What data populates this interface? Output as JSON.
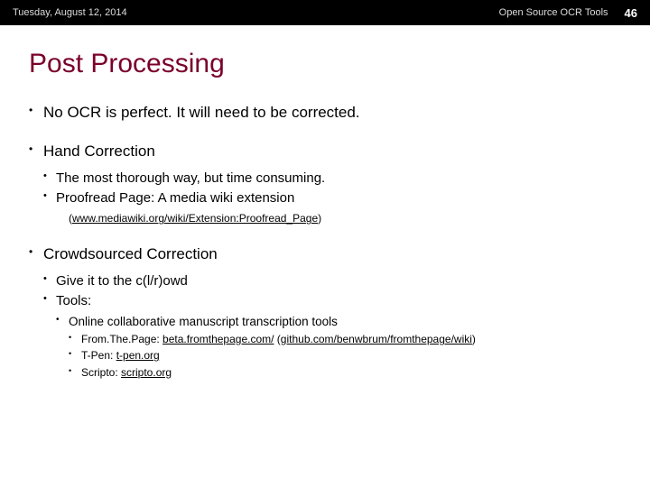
{
  "header": {
    "date": "Tuesday, August 12, 2014",
    "topic": "Open Source OCR Tools",
    "page": "46"
  },
  "title": "Post Processing",
  "bullets": {
    "b1": "No OCR is perfect. It will need to be corrected.",
    "b2": "Hand Correction",
    "b2_1": "The most thorough way, but time consuming.",
    "b2_2": "Proofread Page: A media wiki extension",
    "b2_2_linkpre": "(",
    "b2_2_link": "www.mediawiki.org/wiki/Extension:Proofread_Page",
    "b2_2_linkpost": ")",
    "b3": "Crowdsourced Correction",
    "b3_1": "Give it to the c(l/r)owd",
    "b3_2": "Tools:",
    "b3_2_1": "Online collaborative manuscript transcription tools",
    "b3_2_1_1_pre": "From.The.Page: ",
    "b3_2_1_1_link1": "beta.fromthepage.com/",
    "b3_2_1_1_mid": " (",
    "b3_2_1_1_link2": "github.com/benwbrum/fromthepage/wiki",
    "b3_2_1_1_post": ")",
    "b3_2_1_2_pre": "T-Pen: ",
    "b3_2_1_2_link": "t-pen.org",
    "b3_2_1_3_pre": "Scripto: ",
    "b3_2_1_3_link": "scripto.org"
  }
}
